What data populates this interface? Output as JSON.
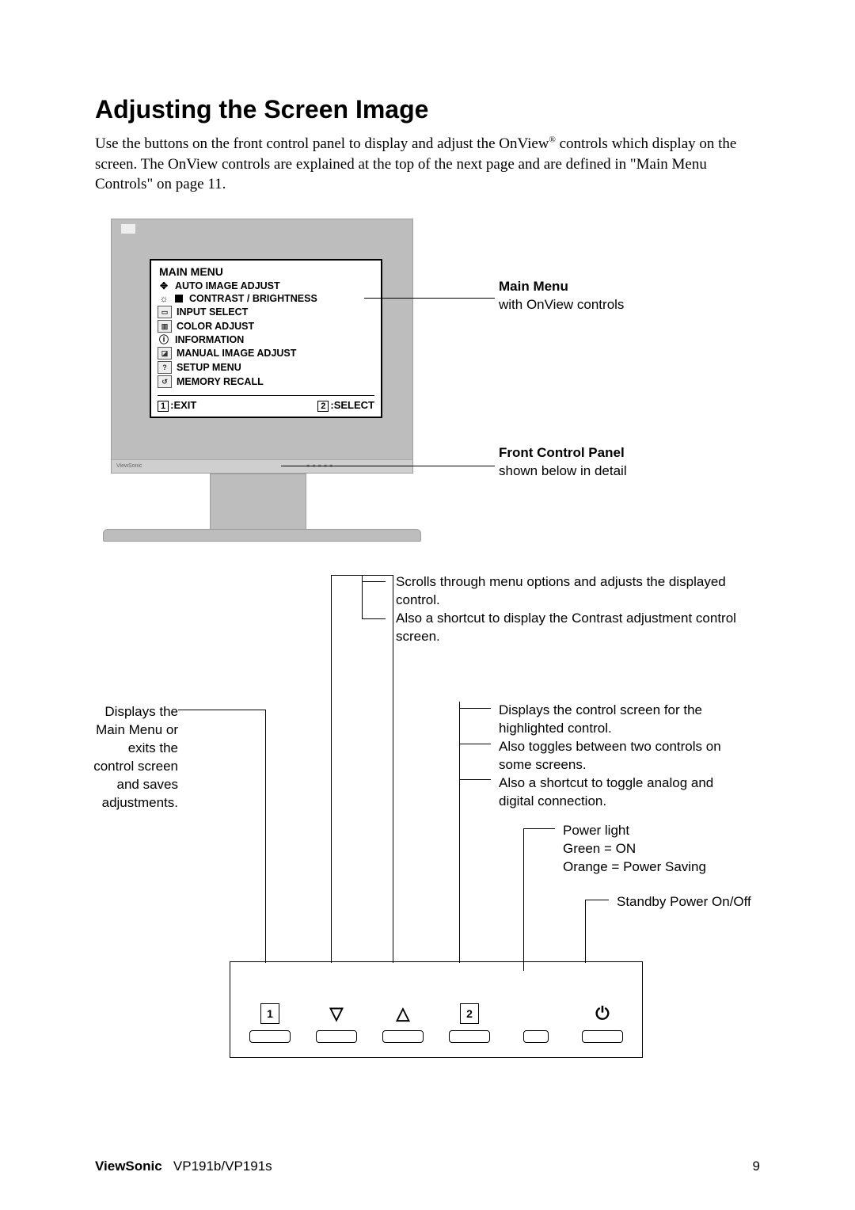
{
  "heading": "Adjusting the Screen Image",
  "intro_parts": {
    "p1": "Use the buttons on the front control panel to display and adjust the OnView",
    "reg": "®",
    "p2": " controls which display on the screen. The OnView controls are explained at the top of the next page and are defined in \"Main Menu Controls\" on page 11."
  },
  "osd": {
    "title": "MAIN MENU",
    "items": [
      {
        "icon": "✥",
        "label": "AUTO IMAGE ADJUST"
      },
      {
        "icon": "☼",
        "label": "CONTRAST / BRIGHTNESS"
      },
      {
        "icon": "▭",
        "label": "INPUT SELECT"
      },
      {
        "icon": "▥",
        "label": "COLOR ADJUST"
      },
      {
        "icon": "ⓘ",
        "label": "INFORMATION"
      },
      {
        "icon": "◪",
        "label": "MANUAL IMAGE ADJUST"
      },
      {
        "icon": "?",
        "label": "SETUP MENU"
      },
      {
        "icon": "↺",
        "label": "MEMORY RECALL"
      }
    ],
    "exit_key": "1",
    "exit_label": ":EXIT",
    "select_key": "2",
    "select_label": ":SELECT"
  },
  "bezel_brand": "ViewSonic",
  "annot": {
    "main_menu_title": "Main Menu",
    "main_menu_sub": "with OnView controls",
    "front_panel_title": "Front Control Panel",
    "front_panel_sub": "shown below in detail",
    "scroll_l1": "Scrolls through menu options and adjusts the displayed control.",
    "scroll_l2": "Also a shortcut to display the Contrast adjustment control screen.",
    "btn1_l1": "Displays the Main Menu or exits the control screen and saves adjustments.",
    "btn2_l1": "Displays the control screen for the highlighted control.",
    "btn2_l2": "Also toggles between two controls on some screens.",
    "btn2_l3": "Also a shortcut to toggle analog and digital connection.",
    "power_title": "Power light",
    "power_on": "Green = ON",
    "power_saving": "Orange = Power Saving",
    "standby": "Standby Power On/Off"
  },
  "buttons": {
    "b1": "1",
    "down": "▽",
    "up": "△",
    "b2": "2",
    "power": "⏻"
  },
  "footer_brand": "ViewSonic",
  "footer_model": "VP191b/VP191s",
  "footer_page": "9"
}
